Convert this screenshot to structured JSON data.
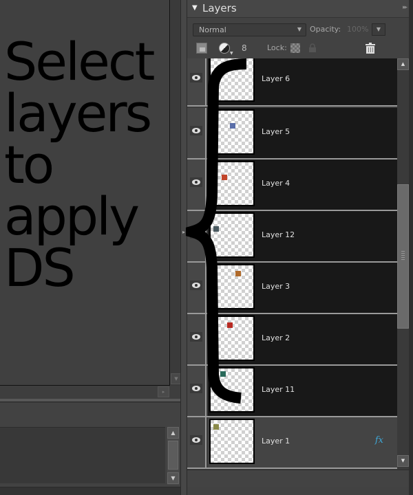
{
  "layers_panel": {
    "title": "Layers",
    "blend_mode": "Normal",
    "opacity_label": "Opacity:",
    "opacity_value": "100%",
    "lock_label": "Lock:",
    "layers": [
      {
        "name": "Layer 6",
        "visible": true,
        "selected": true,
        "has_effects": false
      },
      {
        "name": "Layer 5",
        "visible": true,
        "selected": true,
        "has_effects": false
      },
      {
        "name": "Layer 4",
        "visible": true,
        "selected": true,
        "has_effects": false
      },
      {
        "name": "Layer 12",
        "visible": true,
        "selected": true,
        "has_effects": false
      },
      {
        "name": "Layer 3",
        "visible": true,
        "selected": true,
        "has_effects": false
      },
      {
        "name": "Layer 2",
        "visible": true,
        "selected": true,
        "has_effects": false
      },
      {
        "name": "Layer 11",
        "visible": true,
        "selected": true,
        "has_effects": false
      },
      {
        "name": "Layer 1",
        "visible": true,
        "selected": false,
        "has_effects": true,
        "effects_label": "fx"
      }
    ]
  },
  "annotation": {
    "text_lines": [
      "Select",
      "layers",
      "to",
      "apply",
      "DS"
    ]
  },
  "icons": {
    "panel_collapse": "▼",
    "panel_menu": "▸▸",
    "dropdown": "▼",
    "scroll_up": "▲",
    "scroll_down": "▼",
    "link": "8",
    "lock": "🔒",
    "panel_expand": "▸"
  },
  "colors": {
    "selected_row": "#181818",
    "unselected_row": "#444444",
    "fx_accent": "#3fa7d6"
  }
}
